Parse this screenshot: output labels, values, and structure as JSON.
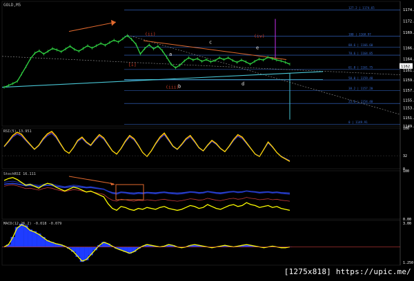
{
  "header": {
    "symbol": "GOLD,M5"
  },
  "watermark": "[1275x818] https://upic.me/",
  "colors": {
    "bg": "#000000",
    "price": "#2ecc40",
    "axis": "#ffffff",
    "fib": "#3a6fd8",
    "trend_cyan": "#49c7d6",
    "trend_orange": "#e36a2e",
    "wave_label": "#d9412a",
    "letter_label": "#e6e6e6",
    "rsi": "#ffd700",
    "stoch": "#ffff00",
    "macd_hist": "#1e3cff",
    "macd_line": "#ffff00",
    "divider": "#7a7a7a",
    "purple": "#a829c9"
  },
  "chart_data": [
    {
      "type": "line",
      "title": "GOLD,M5",
      "yticks": [
        "1174.70",
        "1172.25",
        "1169.80",
        "1166.42",
        "1164.02",
        "1161.62",
        "1159.47",
        "1157.22",
        "1155.07",
        "1153.42",
        "1151.27",
        "1149.52"
      ],
      "current_price": "1162.51",
      "series": [
        {
          "values": [
            1157.9,
            1158.3,
            1158.7,
            1159.2,
            1160.8,
            1162.4,
            1164.1,
            1165.3,
            1165.8,
            1165.1,
            1165.7,
            1166.3,
            1166.0,
            1165.6,
            1166.2,
            1166.8,
            1166.1,
            1165.7,
            1166.3,
            1166.9,
            1166.4,
            1166.9,
            1167.4,
            1167.0,
            1167.6,
            1168.1,
            1167.7,
            1168.4,
            1169.1,
            1168.3,
            1167.2,
            1165.1,
            1166.3,
            1167.1,
            1166.2,
            1166.8,
            1165.8,
            1164.4,
            1162.9,
            1162.1,
            1162.7,
            1163.6,
            1164.3,
            1163.8,
            1164.1,
            1163.5,
            1163.9,
            1163.4,
            1163.7,
            1164.3,
            1163.9,
            1164.3,
            1163.7,
            1163.3,
            1163.8,
            1163.4,
            1162.9,
            1163.5,
            1164.0,
            1163.8,
            1164.4,
            1164.1,
            1163.8,
            1163.6,
            1163.3,
            1162.9
          ]
        }
      ],
      "fib_levels": [
        {
          "label": "127.2 | 1174.65",
          "value": 1174.65
        },
        {
          "label": "100 | 1168.97",
          "value": 1168.97
        },
        {
          "label": "88.6 | 1166.60",
          "value": 1166.6
        },
        {
          "label": "78.6 | 1164.85",
          "value": 1164.85
        },
        {
          "label": "61.8 | 1161.75",
          "value": 1161.75
        },
        {
          "label": "50.0 | 1159.48",
          "value": 1159.48
        },
        {
          "label": "38.2 | 1157.20",
          "value": 1157.2
        },
        {
          "label": "23.6 | 1154.40",
          "value": 1154.4
        },
        {
          "label": "0 | 1149.91",
          "value": 1149.91
        }
      ],
      "wave_labels": [
        "[i]",
        "(ii)",
        "(iii)",
        "(iv)"
      ],
      "letter_labels": [
        "a",
        "b",
        "c",
        "d",
        "e"
      ]
    },
    {
      "type": "line",
      "title": "RSI(5) 13.951",
      "ylim": [
        0,
        100
      ],
      "yticks": [
        "100",
        "32",
        "0"
      ],
      "values": [
        55,
        68,
        82,
        90,
        85,
        72,
        60,
        48,
        58,
        74,
        86,
        92,
        80,
        62,
        45,
        38,
        52,
        70,
        78,
        66,
        58,
        72,
        84,
        76,
        60,
        44,
        36,
        50,
        68,
        82,
        74,
        58,
        40,
        30,
        44,
        62,
        78,
        88,
        72,
        56,
        48,
        60,
        74,
        82,
        68,
        52,
        44,
        58,
        70,
        62,
        50,
        42,
        56,
        72,
        84,
        78,
        64,
        50,
        36,
        30,
        48,
        66,
        54,
        40,
        30,
        24,
        18
      ]
    },
    {
      "type": "line",
      "title": "StochRSI 16.111",
      "ylim": [
        0,
        100
      ],
      "yticks": [
        "100",
        "0.00"
      ],
      "values": [
        80,
        84,
        86,
        82,
        76,
        70,
        72,
        68,
        64,
        70,
        74,
        72,
        66,
        62,
        58,
        62,
        66,
        64,
        60,
        56,
        58,
        54,
        50,
        46,
        32,
        22,
        18,
        26,
        24,
        20,
        18,
        22,
        20,
        24,
        22,
        20,
        24,
        26,
        22,
        20,
        18,
        20,
        24,
        28,
        26,
        22,
        24,
        30,
        26,
        22,
        20,
        24,
        28,
        30,
        26,
        28,
        34,
        30,
        28,
        24,
        26,
        28,
        24,
        26,
        22,
        20,
        18
      ]
    },
    {
      "type": "line",
      "title": "MACD(12,26,2) -0.018 -0.079",
      "yticks": [
        "3.00",
        "1.250"
      ],
      "values": [
        0.0,
        0.3,
        1.2,
        2.4,
        2.8,
        2.6,
        2.1,
        1.9,
        1.6,
        1.2,
        0.8,
        0.6,
        0.4,
        0.3,
        0.1,
        -0.2,
        -0.6,
        -1.2,
        -1.8,
        -1.6,
        -1.0,
        -0.4,
        0.2,
        0.6,
        0.4,
        0.1,
        -0.2,
        -0.4,
        -0.6,
        -0.8,
        -0.6,
        -0.2,
        0.1,
        0.3,
        0.2,
        0.1,
        0.0,
        0.1,
        0.3,
        0.2,
        0.0,
        -0.1,
        0.0,
        0.2,
        0.3,
        0.2,
        0.1,
        0.0,
        -0.1,
        0.0,
        0.1,
        0.2,
        0.1,
        0.0,
        0.1,
        0.2,
        0.3,
        0.2,
        0.1,
        0.0,
        -0.1,
        0.0,
        0.1,
        0.0,
        -0.1,
        -0.1,
        0.0
      ]
    }
  ]
}
